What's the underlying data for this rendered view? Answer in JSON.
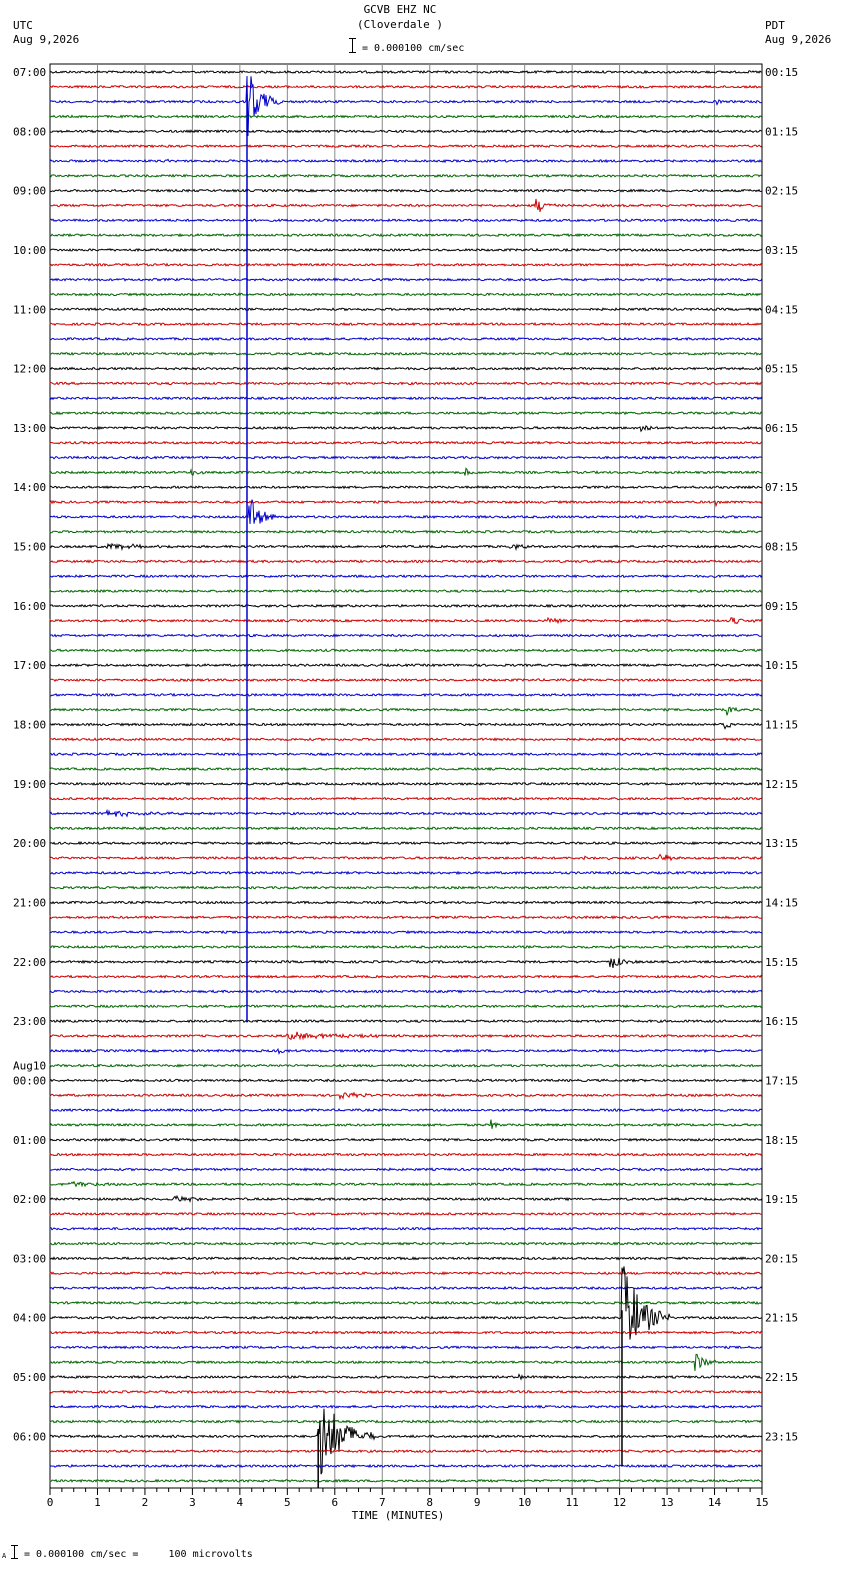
{
  "header": {
    "station": "GCVB EHZ NC",
    "location": "(Cloverdale )",
    "scale_label": "= 0.000100 cm/sec",
    "left_zone": "UTC",
    "left_date": "Aug 9,2026",
    "right_zone": "PDT",
    "right_date": "Aug 9,2026"
  },
  "footer": {
    "scale_marker": "A",
    "scale_label": "= 0.000100 cm/sec =     100 microvolts"
  },
  "chart_data": {
    "type": "line",
    "title": "GCVB EHZ NC (Cloverdale )",
    "xlabel": "TIME (MINUTES)",
    "xlim": [
      0,
      15
    ],
    "x_ticks": [
      "0",
      "1",
      "2",
      "3",
      "4",
      "5",
      "6",
      "7",
      "8",
      "9",
      "10",
      "11",
      "12",
      "13",
      "14",
      "15"
    ],
    "trace_count": 96,
    "trace_minutes": 15,
    "trace_colors": [
      "#000000",
      "#cc0000",
      "#0000cc",
      "#006600"
    ],
    "grid": true,
    "left_labels": [
      {
        "trace": 0,
        "text": "07:00"
      },
      {
        "trace": 4,
        "text": "08:00"
      },
      {
        "trace": 8,
        "text": "09:00"
      },
      {
        "trace": 12,
        "text": "10:00"
      },
      {
        "trace": 16,
        "text": "11:00"
      },
      {
        "trace": 20,
        "text": "12:00"
      },
      {
        "trace": 24,
        "text": "13:00"
      },
      {
        "trace": 28,
        "text": "14:00"
      },
      {
        "trace": 32,
        "text": "15:00"
      },
      {
        "trace": 36,
        "text": "16:00"
      },
      {
        "trace": 40,
        "text": "17:00"
      },
      {
        "trace": 44,
        "text": "18:00"
      },
      {
        "trace": 48,
        "text": "19:00"
      },
      {
        "trace": 52,
        "text": "20:00"
      },
      {
        "trace": 56,
        "text": "21:00"
      },
      {
        "trace": 60,
        "text": "22:00"
      },
      {
        "trace": 64,
        "text": "23:00"
      },
      {
        "trace": 68,
        "text": "00:00",
        "date": "Aug10"
      },
      {
        "trace": 72,
        "text": "01:00"
      },
      {
        "trace": 76,
        "text": "02:00"
      },
      {
        "trace": 80,
        "text": "03:00"
      },
      {
        "trace": 84,
        "text": "04:00"
      },
      {
        "trace": 88,
        "text": "05:00"
      },
      {
        "trace": 92,
        "text": "06:00"
      }
    ],
    "right_labels": [
      {
        "trace": 0,
        "text": "00:15"
      },
      {
        "trace": 4,
        "text": "01:15"
      },
      {
        "trace": 8,
        "text": "02:15"
      },
      {
        "trace": 12,
        "text": "03:15"
      },
      {
        "trace": 16,
        "text": "04:15"
      },
      {
        "trace": 20,
        "text": "05:15"
      },
      {
        "trace": 24,
        "text": "06:15"
      },
      {
        "trace": 28,
        "text": "07:15"
      },
      {
        "trace": 32,
        "text": "08:15"
      },
      {
        "trace": 36,
        "text": "09:15"
      },
      {
        "trace": 40,
        "text": "10:15"
      },
      {
        "trace": 44,
        "text": "11:15"
      },
      {
        "trace": 48,
        "text": "12:15"
      },
      {
        "trace": 52,
        "text": "13:15"
      },
      {
        "trace": 56,
        "text": "14:15"
      },
      {
        "trace": 60,
        "text": "15:15"
      },
      {
        "trace": 64,
        "text": "16:15"
      },
      {
        "trace": 68,
        "text": "17:15"
      },
      {
        "trace": 72,
        "text": "18:15"
      },
      {
        "trace": 76,
        "text": "19:15"
      },
      {
        "trace": 80,
        "text": "20:15"
      },
      {
        "trace": 84,
        "text": "21:15"
      },
      {
        "trace": 88,
        "text": "22:15"
      },
      {
        "trace": 92,
        "text": "23:15"
      }
    ],
    "events": [
      {
        "trace": 2,
        "minute": 4.15,
        "amp": 40,
        "dur": 0.7
      },
      {
        "trace": 2,
        "minute": 14.05,
        "amp": 3,
        "dur": 0.2
      },
      {
        "trace": 6,
        "minute": 2.45,
        "amp": 3,
        "dur": 0.3
      },
      {
        "trace": 9,
        "minute": 10.25,
        "amp": 9,
        "dur": 0.5
      },
      {
        "trace": 24,
        "minute": 12.45,
        "amp": 7,
        "dur": 0.3
      },
      {
        "trace": 27,
        "minute": 2.95,
        "amp": 4,
        "dur": 0.5
      },
      {
        "trace": 27,
        "minute": 8.75,
        "amp": 6,
        "dur": 0.3
      },
      {
        "trace": 29,
        "minute": 14.05,
        "amp": 3,
        "dur": 0.2
      },
      {
        "trace": 30,
        "minute": 4.2,
        "amp": 22,
        "dur": 0.6
      },
      {
        "trace": 32,
        "minute": 1.2,
        "amp": 4,
        "dur": 1.6
      },
      {
        "trace": 32,
        "minute": 9.7,
        "amp": 5,
        "dur": 0.5
      },
      {
        "trace": 37,
        "minute": 10.5,
        "amp": 3,
        "dur": 0.6
      },
      {
        "trace": 37,
        "minute": 14.35,
        "amp": 5,
        "dur": 0.5
      },
      {
        "trace": 43,
        "minute": 14.25,
        "amp": 8,
        "dur": 0.3
      },
      {
        "trace": 44,
        "minute": 14.2,
        "amp": 9,
        "dur": 0.3
      },
      {
        "trace": 50,
        "minute": 1.2,
        "amp": 3,
        "dur": 2.0
      },
      {
        "trace": 53,
        "minute": 11.2,
        "amp": 3,
        "dur": 1.2
      },
      {
        "trace": 53,
        "minute": 12.85,
        "amp": 6,
        "dur": 0.6
      },
      {
        "trace": 60,
        "minute": 11.8,
        "amp": 8,
        "dur": 0.6
      },
      {
        "trace": 65,
        "minute": 5.0,
        "amp": 4,
        "dur": 3.2
      },
      {
        "trace": 66,
        "minute": 4.8,
        "amp": 4,
        "dur": 0.3
      },
      {
        "trace": 69,
        "minute": 6.1,
        "amp": 4,
        "dur": 1.0
      },
      {
        "trace": 71,
        "minute": 9.3,
        "amp": 6,
        "dur": 0.3
      },
      {
        "trace": 75,
        "minute": 0.35,
        "amp": 3,
        "dur": 2.0
      },
      {
        "trace": 76,
        "minute": 2.6,
        "amp": 4,
        "dur": 1.0
      },
      {
        "trace": 81,
        "minute": 3.45,
        "amp": 3,
        "dur": 0.2
      },
      {
        "trace": 84,
        "minute": 12.05,
        "amp": 60,
        "dur": 1.0
      },
      {
        "trace": 87,
        "minute": 13.6,
        "amp": 12,
        "dur": 0.5
      },
      {
        "trace": 88,
        "minute": 9.9,
        "amp": 4,
        "dur": 0.3
      },
      {
        "trace": 92,
        "minute": 2.55,
        "amp": 5,
        "dur": 0.2
      },
      {
        "trace": 92,
        "minute": 5.65,
        "amp": 50,
        "dur": 1.2
      }
    ]
  }
}
